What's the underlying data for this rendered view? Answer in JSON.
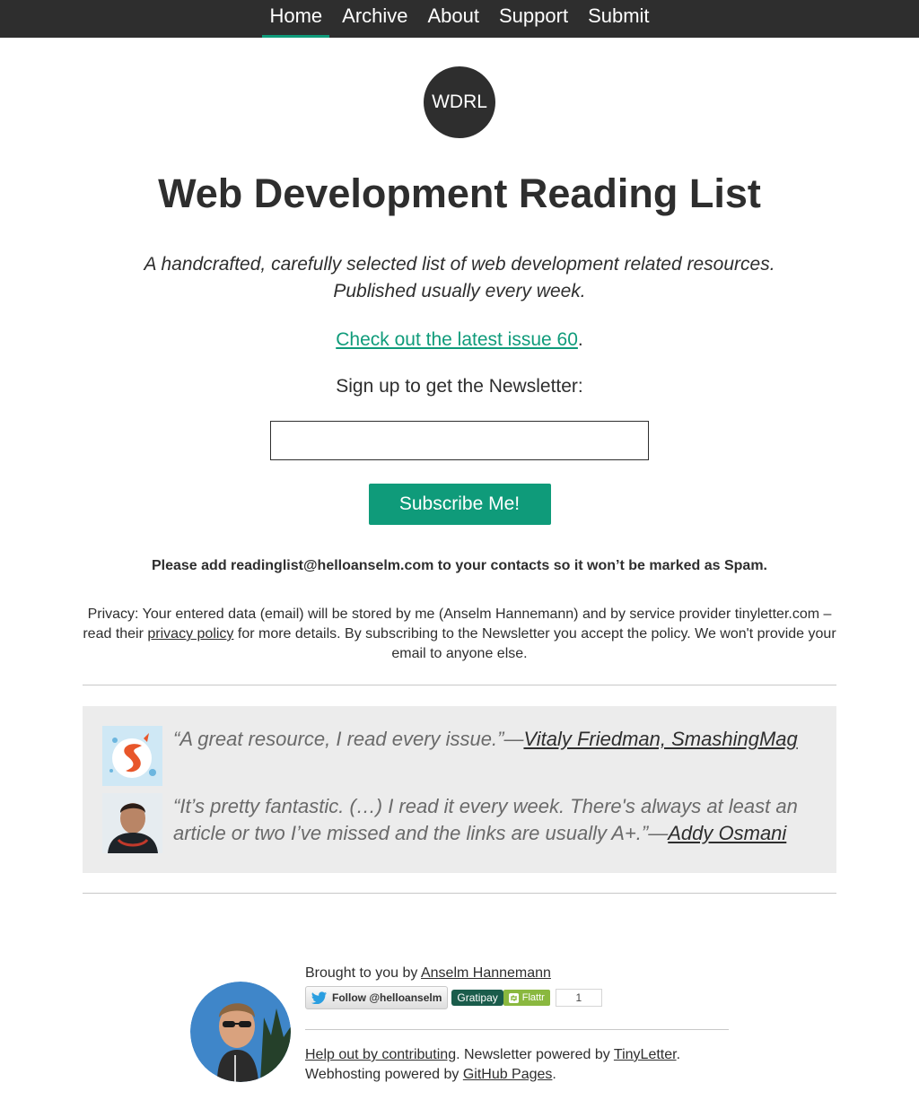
{
  "nav": {
    "items": [
      {
        "label": "Home"
      },
      {
        "label": "Archive"
      },
      {
        "label": "About"
      },
      {
        "label": "Support"
      },
      {
        "label": "Submit"
      }
    ]
  },
  "logo": {
    "text": "WDRL"
  },
  "title": "Web Development Reading List",
  "tagline": {
    "line1": "A handcrafted, carefully selected list of web development related resources.",
    "line2": "Published usually every week."
  },
  "latest": {
    "link": "Check out the latest issue 60",
    "suffix": "."
  },
  "signup": {
    "label": "Sign up to get the Newsletter:",
    "email_value": "",
    "button": "Subscribe Me!"
  },
  "spam_notice": "Please add readinglist@helloanselm.com to your contacts so it won’t be marked as Spam.",
  "privacy": {
    "pre": "Privacy: Your entered data (email) will be stored by me (Anselm Hannemann) and by service provider tinyletter.com – read their ",
    "link": "privacy policy",
    "post": " for more details. By subscribing to the Newsletter you accept the policy. We won't provide your email to anyone else."
  },
  "testimonials": [
    {
      "quote": "“A great resource, I read every issue.”—",
      "author": "Vitaly Friedman, SmashingMag"
    },
    {
      "quote": "“It’s pretty fantastic. (…) I read it every week. There's always at least an article or two I’ve missed and the links are usually A+.”—",
      "author": "Addy Osmani"
    }
  ],
  "footer": {
    "brought_pre": "Brought to you by ",
    "brought_link": "Anselm Hannemann",
    "twitter_button": "Follow @helloanselm",
    "gratipay": "Gratipay",
    "flattr": "Flattr",
    "flattr_count": "1",
    "help_link": "Help out by contributing",
    "help_mid": ". Newsletter powered by ",
    "tinyletter_link": "TinyLetter",
    "line1_end": ".",
    "hosting_pre": "Webhosting powered by ",
    "github_link": "GitHub Pages",
    "line2_end": "."
  }
}
